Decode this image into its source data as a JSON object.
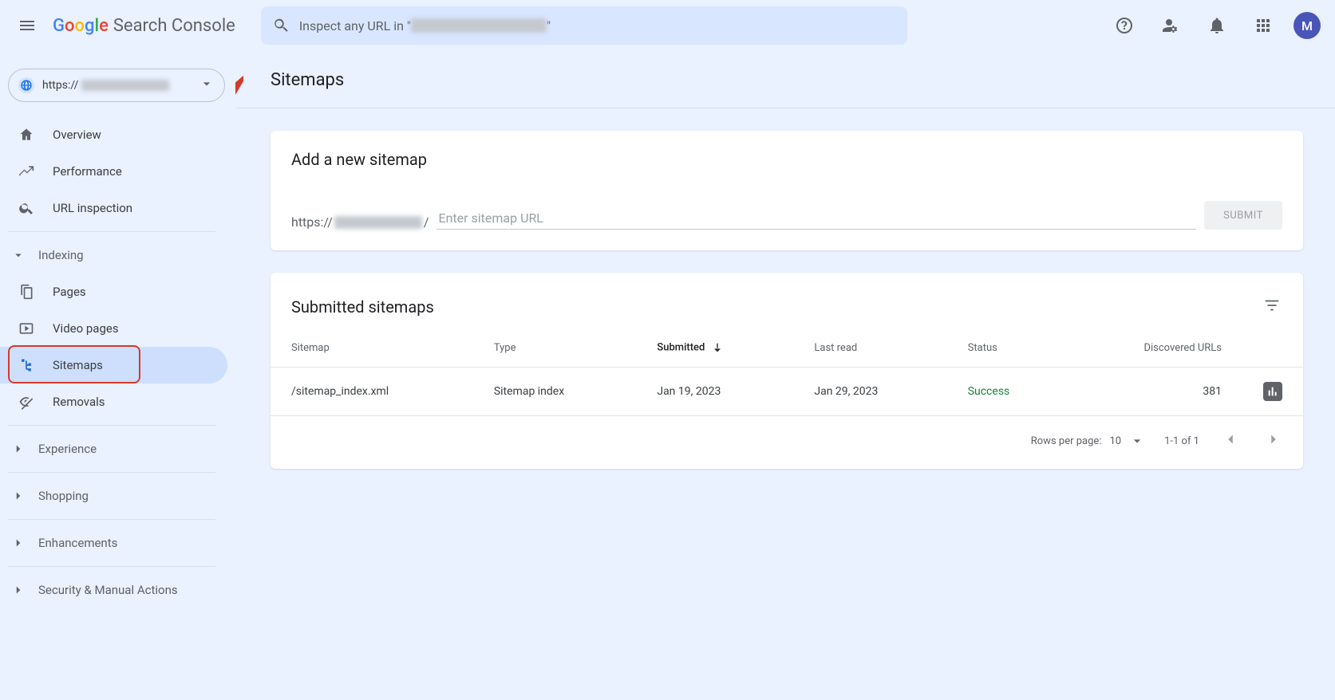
{
  "header": {
    "logo_product": "Search Console",
    "search_prefix": "Inspect any URL in \"",
    "search_suffix": "\"",
    "avatar_initial": "M"
  },
  "property": {
    "scheme": "https://"
  },
  "sidebar": {
    "items": [
      {
        "label": "Overview",
        "icon": "home"
      },
      {
        "label": "Performance",
        "icon": "trend"
      },
      {
        "label": "URL inspection",
        "icon": "search"
      }
    ],
    "section_indexing": "Indexing",
    "indexing_items": [
      {
        "label": "Pages",
        "icon": "pages"
      },
      {
        "label": "Video pages",
        "icon": "video"
      },
      {
        "label": "Sitemaps",
        "icon": "sitemap",
        "active": true
      },
      {
        "label": "Removals",
        "icon": "removals"
      }
    ],
    "sections": [
      "Experience",
      "Shopping",
      "Enhancements",
      "Security & Manual Actions"
    ]
  },
  "page": {
    "title": "Sitemaps"
  },
  "add_card": {
    "title": "Add a new sitemap",
    "prefix_scheme": "https://",
    "prefix_slash": "/",
    "placeholder": "Enter sitemap URL",
    "submit": "SUBMIT"
  },
  "list_card": {
    "title": "Submitted sitemaps",
    "columns": {
      "sitemap": "Sitemap",
      "type": "Type",
      "submitted": "Submitted",
      "last_read": "Last read",
      "status": "Status",
      "discovered": "Discovered URLs"
    },
    "rows": [
      {
        "sitemap": "/sitemap_index.xml",
        "type": "Sitemap index",
        "submitted": "Jan 19, 2023",
        "last_read": "Jan 29, 2023",
        "status": "Success",
        "discovered": "381"
      }
    ],
    "pager": {
      "rows_label": "Rows per page:",
      "rows_value": "10",
      "range": "1-1 of 1"
    }
  }
}
